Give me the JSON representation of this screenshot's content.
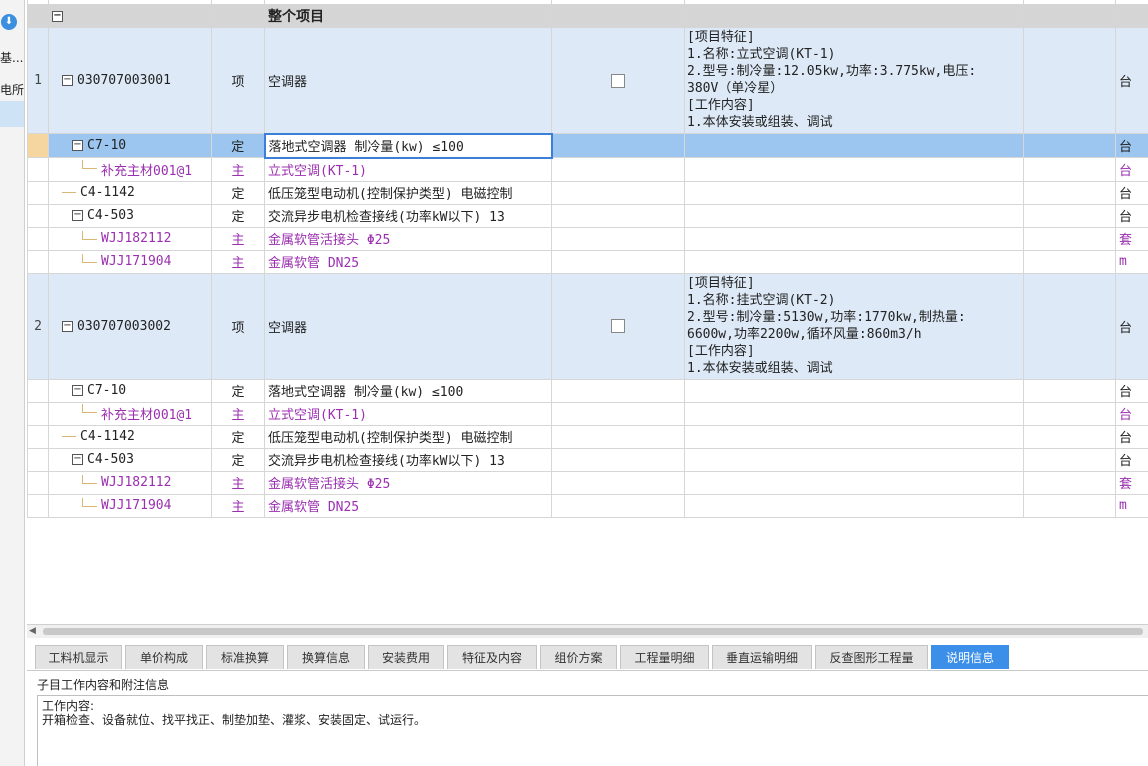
{
  "left_panel": {
    "text1": "基...",
    "text2": "电所"
  },
  "header": {
    "title": "整个项目"
  },
  "bills": [
    {
      "index": "1",
      "code": "030707003001",
      "type": "项",
      "name": "空调器",
      "features": "[项目特征]\n1.名称:立式空调(KT-1)\n2.型号:制冷量:12.05kw,功率:3.775kw,电压:\n380V（单冷星）\n[工作内容]\n1.本体安装或组装、调试",
      "unit": "台",
      "subs": [
        {
          "code": "C7-10",
          "type": "定",
          "name": "落地式空调器 制冷量(kw) ≤100",
          "unit": "台"
        },
        {
          "code": "补充主材001@1",
          "type": "主",
          "name": "立式空调(KT-1)",
          "unit": "台"
        },
        {
          "code": "C4-1142",
          "type": "定",
          "name": "低压笼型电动机(控制保护类型) 电磁控制",
          "unit": "台"
        },
        {
          "code": "C4-503",
          "type": "定",
          "name": "交流异步电机检查接线(功率kW以下) 13",
          "unit": "台"
        },
        {
          "code": "WJJ182112",
          "type": "主",
          "name": "金属软管活接头 Φ25",
          "unit": "套"
        },
        {
          "code": "WJJ171904",
          "type": "主",
          "name": "金属软管 DN25",
          "unit": "m"
        }
      ]
    },
    {
      "index": "2",
      "code": "030707003002",
      "type": "项",
      "name": "空调器",
      "features": "[项目特征]\n1.名称:挂式空调(KT-2)\n2.型号:制冷量:5130w,功率:1770kw,制热量:\n6600w,功率2200w,循环风量:860m3/h\n[工作内容]\n1.本体安装或组装、调试",
      "unit": "台",
      "subs": [
        {
          "code": "C7-10",
          "type": "定",
          "name": "落地式空调器 制冷量(kw) ≤100",
          "unit": "台"
        },
        {
          "code": "补充主材001@1",
          "type": "主",
          "name": "立式空调(KT-1)",
          "unit": "台"
        },
        {
          "code": "C4-1142",
          "type": "定",
          "name": "低压笼型电动机(控制保护类型) 电磁控制",
          "unit": "台"
        },
        {
          "code": "C4-503",
          "type": "定",
          "name": "交流异步电机检查接线(功率kW以下) 13",
          "unit": "台"
        },
        {
          "code": "WJJ182112",
          "type": "主",
          "name": "金属软管活接头 Φ25",
          "unit": "套"
        },
        {
          "code": "WJJ171904",
          "type": "主",
          "name": "金属软管 DN25",
          "unit": "m"
        }
      ]
    }
  ],
  "tabs": [
    "工料机显示",
    "单价构成",
    "标准换算",
    "换算信息",
    "安装费用",
    "特征及内容",
    "组价方案",
    "工程量明细",
    "垂直运输明细",
    "反查图形工程量",
    "说明信息"
  ],
  "active_tab": "说明信息",
  "panel": {
    "label": "子目工作内容和附注信息",
    "line1": "工作内容:",
    "line2": "开箱检查、设备就位、找平找正、制垫加垫、灌浆、安装固定、试运行。"
  },
  "colors": {
    "accent": "#3b8fe8",
    "main_material": "#9b2fb0",
    "bill_row": "#dde9f7",
    "active_row": "#9cc6f0"
  }
}
